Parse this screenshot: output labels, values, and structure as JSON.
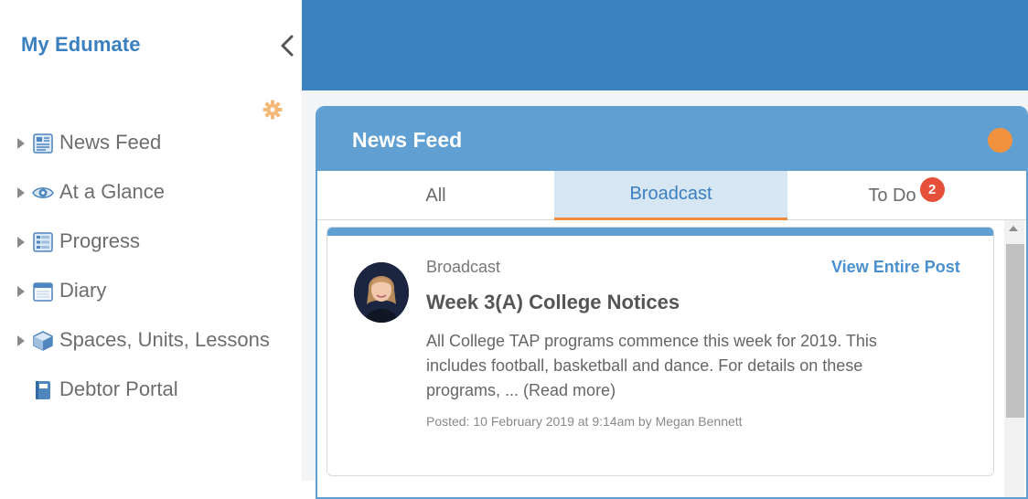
{
  "sidebar": {
    "brand": "My Edumate",
    "items": [
      {
        "label": "News Feed",
        "icon": "news-feed-icon"
      },
      {
        "label": "At a Glance",
        "icon": "eye-icon"
      },
      {
        "label": "Progress",
        "icon": "progress-icon"
      },
      {
        "label": "Diary",
        "icon": "calendar-icon"
      },
      {
        "label": "Spaces, Units, Lessons",
        "icon": "cube-icon"
      },
      {
        "label": "Debtor Portal",
        "icon": "book-icon"
      }
    ]
  },
  "panel": {
    "title": "News Feed",
    "tabs": [
      {
        "label": "All"
      },
      {
        "label": "Broadcast",
        "active": true
      },
      {
        "label": "To Do",
        "badge": "2"
      }
    ]
  },
  "post": {
    "type": "Broadcast",
    "view_link": "View Entire Post",
    "title": "Week 3(A) College Notices",
    "body": "All College   TAP programs commence this week for 2019. This includes football, basketball and dance. For details on these programs, ... (Read more)",
    "meta": "Posted: 10 February 2019 at 9:14am by Megan Bennett"
  },
  "colors": {
    "primary": "#3a82c0",
    "accent": "#f2923e",
    "badge": "#e64f39"
  }
}
